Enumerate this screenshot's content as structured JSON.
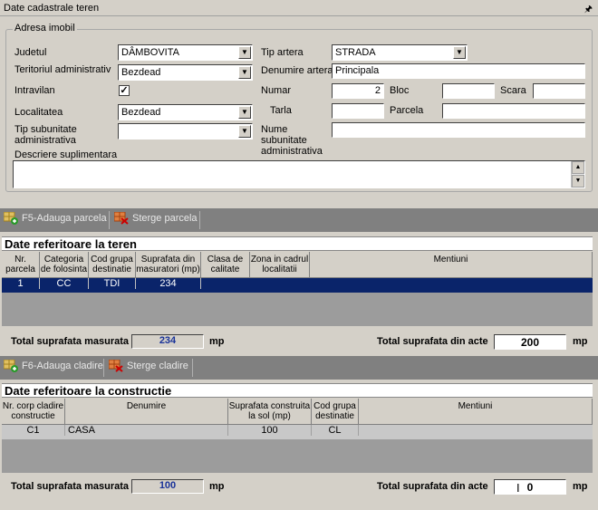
{
  "window": {
    "title": "Date cadastrale teren"
  },
  "adresa": {
    "group_label": "Adresa imobil",
    "judetul_label": "Judetul",
    "judetul_value": "DÂMBOVITA",
    "teritoriul_label": "Teritoriul administrativ",
    "teritoriul_value": "Bezdead",
    "intravilan_label": "Intravilan",
    "intravilan_checked": "✓",
    "localitatea_label": "Localitatea",
    "localitatea_value": "Bezdead",
    "tip_subunitate_label": "Tip subunitate administrativa",
    "tip_subunitate_value": "",
    "descriere_label": "Descriere suplimentara",
    "descriere_value": "",
    "tip_artera_label": "Tip artera",
    "tip_artera_value": "STRADA",
    "denumire_artera_label": "Denumire artera",
    "denumire_artera_value": "Principala",
    "numar_label": "Numar",
    "numar_value": "2",
    "bloc_label": "Bloc",
    "bloc_value": "",
    "scara_label": "Scara",
    "scara_value": "",
    "tarla_label": "Tarla",
    "tarla_value": "",
    "parcela_label": "Parcela",
    "parcela_value": "",
    "nume_subunitate_label": "Nume subunitate administrativa",
    "nume_subunitate_value": ""
  },
  "parcele_toolbar": {
    "add_label": "F5-Adauga parcela",
    "delete_label": "Sterge parcela"
  },
  "teren": {
    "title": "Date referitoare la teren",
    "headers": [
      "Nr. parcela",
      "Categoria de folosinta",
      "Cod grupa destinatie",
      "Suprafata din masuratori (mp)",
      "Clasa de calitate",
      "Zona in cadrul localitatii",
      "Mentiuni"
    ],
    "rows": [
      {
        "nr": "1",
        "categoria": "CC",
        "cod": "TDI",
        "suprafata": "234",
        "clasa": "",
        "zona": "",
        "mentiuni": ""
      }
    ],
    "total_masurata_label": "Total suprafata masurata",
    "total_masurata_value": "234",
    "unit": "mp",
    "total_acte_label": "Total suprafata din acte",
    "total_acte_value": "200"
  },
  "cladiri_toolbar": {
    "add_label": "F6-Adauga cladire",
    "delete_label": "Sterge cladire"
  },
  "constructie": {
    "title": "Date referitoare la constructie",
    "headers": [
      "Nr. corp cladire constructie",
      "Denumire",
      "Suprafata construita la sol (mp)",
      "Cod grupa destinatie",
      "Mentiuni"
    ],
    "rows": [
      {
        "nr": "C1",
        "denumire": "CASA",
        "suprafata": "100",
        "cod": "CL",
        "mentiuni": ""
      }
    ],
    "total_masurata_label": "Total suprafata masurata",
    "total_masurata_value": "100",
    "unit": "mp",
    "total_acte_label": "Total suprafata din acte",
    "total_acte_value": "0"
  },
  "icons": {
    "pin": "pin-icon",
    "combo": "chevron-down-icon",
    "add": "add-grid-icon",
    "delete": "delete-grid-icon"
  }
}
